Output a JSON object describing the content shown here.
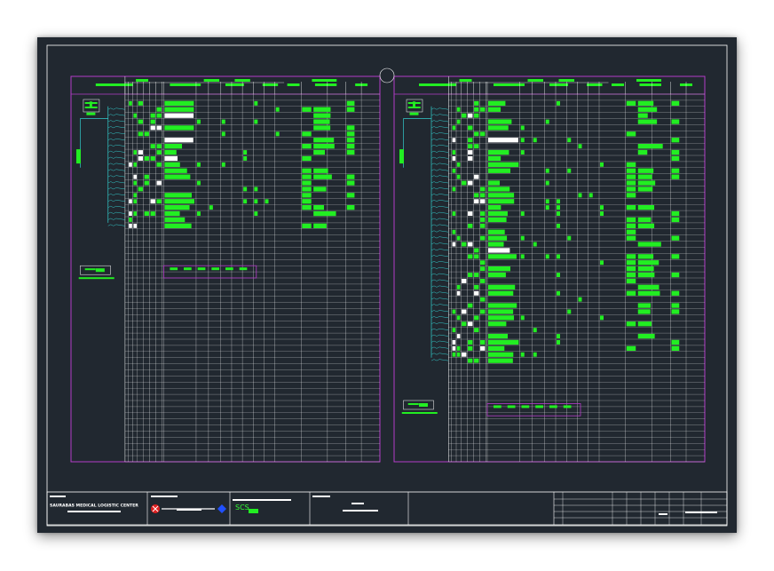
{
  "drawing": {
    "colors": {
      "background": "#212830",
      "border": "#ffffff",
      "schedule_frame": "#b43cc8",
      "grid_line": "#ffffff",
      "data_fill": "#22ee22",
      "highlight_fill": "#ffffff",
      "wire": "#33cccc",
      "title_block_line": "#ffffff",
      "logo_red": "#e02020",
      "logo_blue": "#2050ff"
    },
    "sheets": [
      {
        "name": "left-schedule-sheet"
      },
      {
        "name": "right-schedule-sheet"
      }
    ]
  },
  "title_block": {
    "project_name": "SAURABAS MEDICAL LOGISTIC CENTER",
    "contractor_mark": "SCS",
    "icons": [
      "red-logo-icon",
      "blue-logo-icon"
    ]
  }
}
